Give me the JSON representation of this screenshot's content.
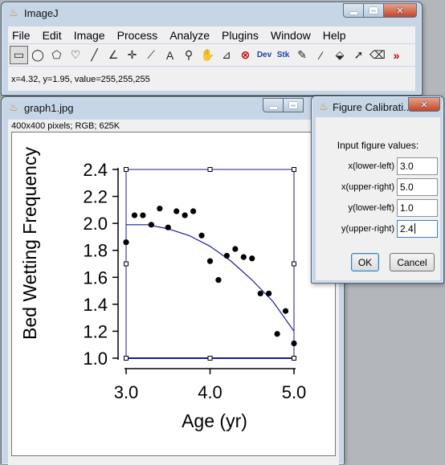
{
  "imagej": {
    "title": "ImageJ",
    "menu": [
      "File",
      "Edit",
      "Image",
      "Process",
      "Analyze",
      "Plugins",
      "Window",
      "Help"
    ],
    "tools": [
      {
        "name": "rectangle-tool-icon",
        "glyph": "▭",
        "selected": true
      },
      {
        "name": "oval-tool-icon",
        "glyph": "◯"
      },
      {
        "name": "polygon-tool-icon",
        "glyph": "⬠"
      },
      {
        "name": "freehand-tool-icon",
        "glyph": "♡"
      },
      {
        "name": "line-tool-icon",
        "glyph": "╱"
      },
      {
        "name": "angle-tool-icon",
        "glyph": "∠"
      },
      {
        "name": "point-tool-icon",
        "glyph": "✛"
      },
      {
        "name": "wand-tool-icon",
        "glyph": "⟋"
      },
      {
        "name": "text-tool-icon",
        "glyph": "A"
      },
      {
        "name": "magnifier-tool-icon",
        "glyph": "⚲"
      },
      {
        "name": "hand-tool-icon",
        "glyph": "✋"
      },
      {
        "name": "dropper-tool-icon",
        "glyph": "⊿"
      },
      {
        "name": "stop-tool-icon",
        "glyph": "⊗",
        "red": true
      },
      {
        "name": "dev-tool-icon",
        "glyph": "Dev",
        "small": true
      },
      {
        "name": "stk-tool-icon",
        "glyph": "Stk",
        "small": true
      },
      {
        "name": "pencil-tool-icon",
        "glyph": "✎"
      },
      {
        "name": "brush-tool-icon",
        "glyph": "⁄"
      },
      {
        "name": "flood-fill-tool-icon",
        "glyph": "⬙"
      },
      {
        "name": "arrow-tool-icon",
        "glyph": "➚"
      },
      {
        "name": "eraser-tool-icon",
        "glyph": "⌫"
      },
      {
        "name": "more-tools-icon",
        "glyph": "»",
        "red": true
      }
    ],
    "status": "x=4.32, y=1.95, value=255,255,255"
  },
  "graph_window": {
    "title": "graph1.jpg",
    "info": "400x400 pixels; RGB; 625K"
  },
  "chart_data": {
    "type": "scatter",
    "ylabel": "Bed Wetting Frequency",
    "xlabel": "Age (yr)",
    "xlim": [
      3.0,
      5.0
    ],
    "ylim": [
      1.0,
      2.4
    ],
    "xticks": [
      "3.0",
      "4.0",
      "5.0"
    ],
    "yticks": [
      "1.0",
      "1.2",
      "1.4",
      "1.6",
      "1.8",
      "2.0",
      "2.2",
      "2.4"
    ],
    "points": [
      {
        "x": 3.0,
        "y": 1.86
      },
      {
        "x": 3.1,
        "y": 2.06
      },
      {
        "x": 3.2,
        "y": 2.06
      },
      {
        "x": 3.3,
        "y": 1.99
      },
      {
        "x": 3.4,
        "y": 2.11
      },
      {
        "x": 3.5,
        "y": 1.97
      },
      {
        "x": 3.6,
        "y": 2.09
      },
      {
        "x": 3.7,
        "y": 2.06
      },
      {
        "x": 3.8,
        "y": 2.09
      },
      {
        "x": 3.9,
        "y": 1.91
      },
      {
        "x": 4.0,
        "y": 1.72
      },
      {
        "x": 4.1,
        "y": 1.58
      },
      {
        "x": 4.2,
        "y": 1.76
      },
      {
        "x": 4.3,
        "y": 1.81
      },
      {
        "x": 4.4,
        "y": 1.75
      },
      {
        "x": 4.5,
        "y": 1.74
      },
      {
        "x": 4.6,
        "y": 1.48
      },
      {
        "x": 4.7,
        "y": 1.48
      },
      {
        "x": 4.8,
        "y": 1.18
      },
      {
        "x": 4.9,
        "y": 1.35
      },
      {
        "x": 5.0,
        "y": 1.11
      }
    ],
    "fit_curve": [
      {
        "x": 3.0,
        "y": 1.99
      },
      {
        "x": 3.25,
        "y": 1.99
      },
      {
        "x": 3.5,
        "y": 1.96
      },
      {
        "x": 3.75,
        "y": 1.91
      },
      {
        "x": 4.0,
        "y": 1.83
      },
      {
        "x": 4.25,
        "y": 1.72
      },
      {
        "x": 4.5,
        "y": 1.58
      },
      {
        "x": 4.75,
        "y": 1.42
      },
      {
        "x": 5.0,
        "y": 1.2
      }
    ],
    "colors": {
      "points": "#000000",
      "fit": "#1a1aa0",
      "selection": "#1a1a8c"
    }
  },
  "calibration": {
    "title": "Figure Calibrati...",
    "heading": "Input figure values:",
    "fields": [
      {
        "label": "x(lower-left)",
        "value": "3.0"
      },
      {
        "label": "x(upper-right)",
        "value": "5.0"
      },
      {
        "label": "y(lower-left)",
        "value": "1.0"
      },
      {
        "label": "y(upper-right)",
        "value": "2.4"
      }
    ],
    "ok_label": "OK",
    "cancel_label": "Cancel"
  }
}
